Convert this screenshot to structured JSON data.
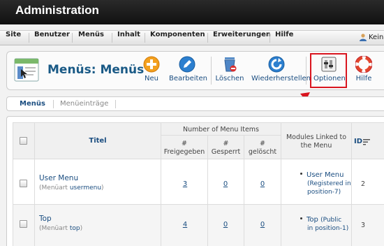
{
  "header": {
    "title": "Administration"
  },
  "menubar": {
    "items": [
      "Site",
      "Benutzer",
      "Menüs",
      "Inhalt",
      "Komponenten",
      "Erweiterungen",
      "Hilfe"
    ],
    "user_label": "Keine"
  },
  "toolbar": {
    "title": "Menüs: Menüs",
    "buttons": {
      "new": "Neu",
      "edit": "Bearbeiten",
      "delete": "Löschen",
      "restore": "Wiederherstellen",
      "options": "Optionen",
      "help": "Hilfe"
    }
  },
  "subnav": {
    "tabs": [
      "Menüs",
      "Menüeinträge"
    ]
  },
  "table": {
    "columns": {
      "title": "Titel",
      "number_group": "Number of Menu Items",
      "hash": "#",
      "published": "Freigegeben",
      "unpublished": "Gesperrt",
      "trashed": "gelöscht",
      "modules_line1": "Modules Linked to",
      "modules_line2": "the Menu",
      "id": "ID"
    },
    "type_prefix": "(Menüart",
    "type_suffix": ")",
    "rows": [
      {
        "name": "User Menu",
        "type": "usermenu",
        "published": "3",
        "unpublished": "0",
        "trashed": "0",
        "module": "User Menu",
        "module_note_1": "(Registered in",
        "module_note_2": "position-7)",
        "id": "2"
      },
      {
        "name": "Top",
        "type": "top",
        "published": "4",
        "unpublished": "0",
        "trashed": "0",
        "module": "Top",
        "module_note_1": "(Public",
        "module_note_2": "in position-1)",
        "id": "3"
      }
    ]
  },
  "colors": {
    "accent": "#1a5a86",
    "highlight": "#d9151f",
    "topbar": "#1c1c1c"
  }
}
